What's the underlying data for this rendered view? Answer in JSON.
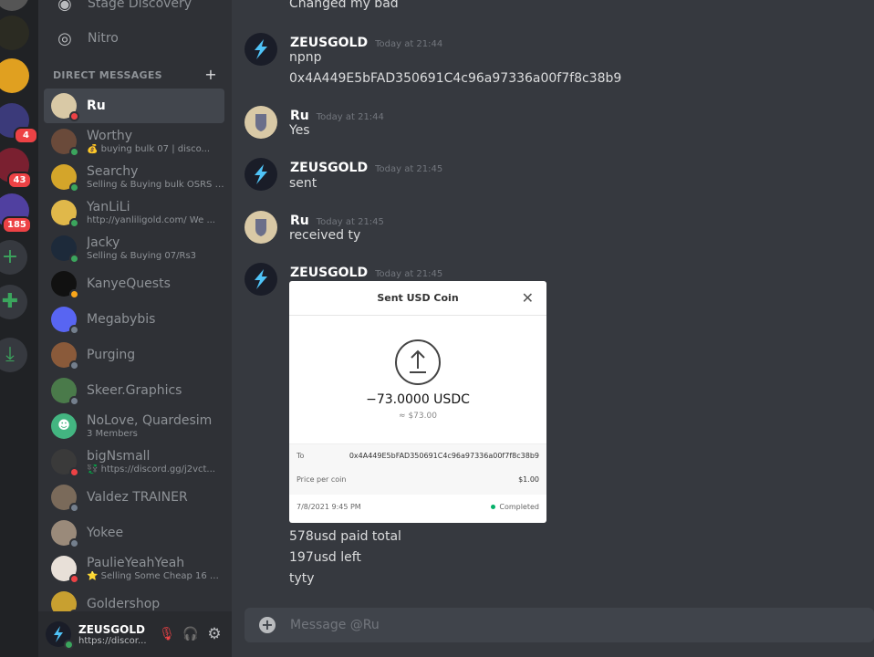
{
  "sidebar": {
    "nav": [
      {
        "label": "Stage Discovery",
        "icon": "stage-icon"
      },
      {
        "label": "Nitro",
        "icon": "nitro-icon"
      }
    ],
    "dm_header": "DIRECT MESSAGES",
    "dms": [
      {
        "name": "Ru",
        "status_text": "",
        "status": "dnd"
      },
      {
        "name": "Worthy",
        "status_text": "💰 buying bulk 07 | disco...",
        "status": "on"
      },
      {
        "name": "Searchy",
        "status_text": "Selling & Buying bulk OSRS / ...",
        "status": "on"
      },
      {
        "name": "YanLiLi",
        "status_text": "http://yanliligold.com/ We ...",
        "status": "on"
      },
      {
        "name": "Jacky",
        "status_text": "Selling & Buying 07/Rs3",
        "status": "on"
      },
      {
        "name": "KanyeQuests",
        "status_text": "",
        "status": "idle"
      },
      {
        "name": "Megabybis",
        "status_text": "",
        "status": "off"
      },
      {
        "name": "Purging",
        "status_text": "",
        "status": "off"
      },
      {
        "name": "Skeer.Graphics",
        "status_text": "",
        "status": "off"
      },
      {
        "name": "NoLove, Quardesim",
        "status_text": "3 Members",
        "status": ""
      },
      {
        "name": "bigNsmall",
        "status_text": "💱 https://discord.gg/j2vct...",
        "status": "dnd"
      },
      {
        "name": "Valdez TRAINER",
        "status_text": "",
        "status": "off"
      },
      {
        "name": "Yokee",
        "status_text": "",
        "status": "off"
      },
      {
        "name": "PaulieYeahYeah",
        "status_text": "⭐ Selling Some Cheap 16 Da...",
        "status": "dnd"
      },
      {
        "name": "Goldershop",
        "status_text": "",
        "status": "off"
      }
    ]
  },
  "guilds": {
    "badges": [
      "4",
      "43",
      "185"
    ]
  },
  "user": {
    "name": "ZEUSGOLD",
    "tag": "https://discor..."
  },
  "chat": {
    "first_line": "Changed my bad",
    "messages": [
      {
        "author": "ZEUSGOLD",
        "time": "Today at 21:44",
        "lines": [
          "npnp",
          "0x4A449E5bFAD350691C4c96a97336a00f7f8c38b9"
        ]
      },
      {
        "author": "Ru",
        "time": "Today at 21:44",
        "lines": [
          "Yes"
        ]
      },
      {
        "author": "ZEUSGOLD",
        "time": "Today at 21:45",
        "lines": [
          "sent"
        ]
      },
      {
        "author": "Ru",
        "time": "Today at 21:45",
        "lines": [
          "received ty"
        ]
      },
      {
        "author": "ZEUSGOLD",
        "time": "Today at 21:45",
        "lines": [
          "578usd paid total",
          "197usd left",
          "tyty"
        ]
      }
    ],
    "receipt": {
      "title": "Sent USD Coin",
      "amount": "−73.0000 USDC",
      "usd": "≈ $73.00",
      "to_label": "To",
      "to_value": "0x4A449E5bFAD350691C4c96a97336a00f7f8c38b9",
      "price_label": "Price per coin",
      "price_value": "$1.00",
      "date": "7/8/2021 9:45 PM",
      "status": "Completed"
    },
    "composer_placeholder": "Message @Ru"
  },
  "colors": {
    "accent_green": "#3ba55d",
    "badge_red": "#ed4245",
    "background": "#36393f"
  }
}
